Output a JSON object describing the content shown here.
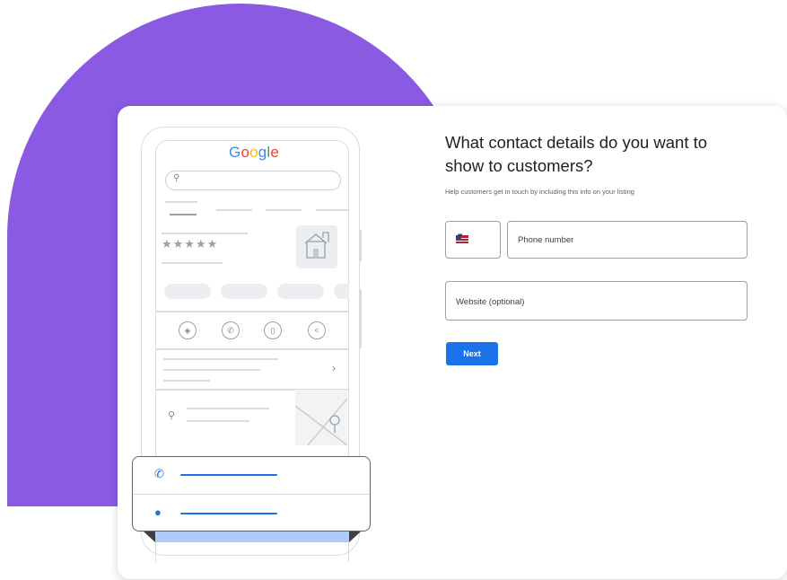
{
  "mockup": {
    "logo_text": "Google",
    "logo_colors": [
      "#4285f4",
      "#ea4335",
      "#fbbc05",
      "#4285f4",
      "#34a853",
      "#ea4335"
    ],
    "rating_stars": "★★★★★",
    "action_icons": [
      "directions-icon",
      "phone-icon",
      "bookmark-icon",
      "share-icon"
    ]
  },
  "form": {
    "heading": "What contact details do you want to show to customers?",
    "subtext": "Help customers get in touch by including this info on your listing",
    "phone_placeholder": "Phone number",
    "country_flag": "us-flag-icon",
    "website_placeholder": "Website (optional)",
    "next_label": "Next"
  },
  "colors": {
    "accent_purple": "#8b5ae3",
    "primary_blue": "#1a73e8"
  }
}
